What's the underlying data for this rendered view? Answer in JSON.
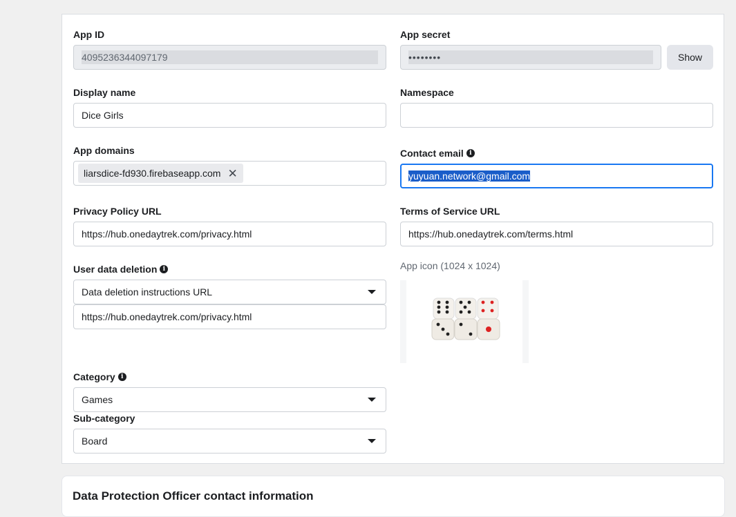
{
  "form": {
    "app_id": {
      "label": "App ID",
      "value": "4095236344097179"
    },
    "app_secret": {
      "label": "App secret",
      "value": "••••••••",
      "show_button": "Show"
    },
    "display_name": {
      "label": "Display name",
      "value": "Dice Girls"
    },
    "namespace": {
      "label": "Namespace",
      "value": ""
    },
    "app_domains": {
      "label": "App domains",
      "chips": [
        "liarsdice-fd930.firebaseapp.com"
      ]
    },
    "contact_email": {
      "label": "Contact email",
      "value": "yuyuan.network@gmail.com"
    },
    "privacy_policy": {
      "label": "Privacy Policy URL",
      "value": "https://hub.onedaytrek.com/privacy.html"
    },
    "terms_of_service": {
      "label": "Terms of Service URL",
      "value": "https://hub.onedaytrek.com/terms.html"
    },
    "user_data_deletion": {
      "label": "User data deletion",
      "type_value": "Data deletion instructions URL",
      "url_value": "https://hub.onedaytrek.com/privacy.html"
    },
    "app_icon": {
      "label": "App icon (1024 x 1024)"
    },
    "category": {
      "label": "Category",
      "value": "Games"
    },
    "sub_category": {
      "label": "Sub-category",
      "value": "Board"
    }
  },
  "dpo_section": {
    "title": "Data Protection Officer contact information"
  },
  "colors": {
    "focus": "#1877f2",
    "selection": "#1a5dc9"
  }
}
